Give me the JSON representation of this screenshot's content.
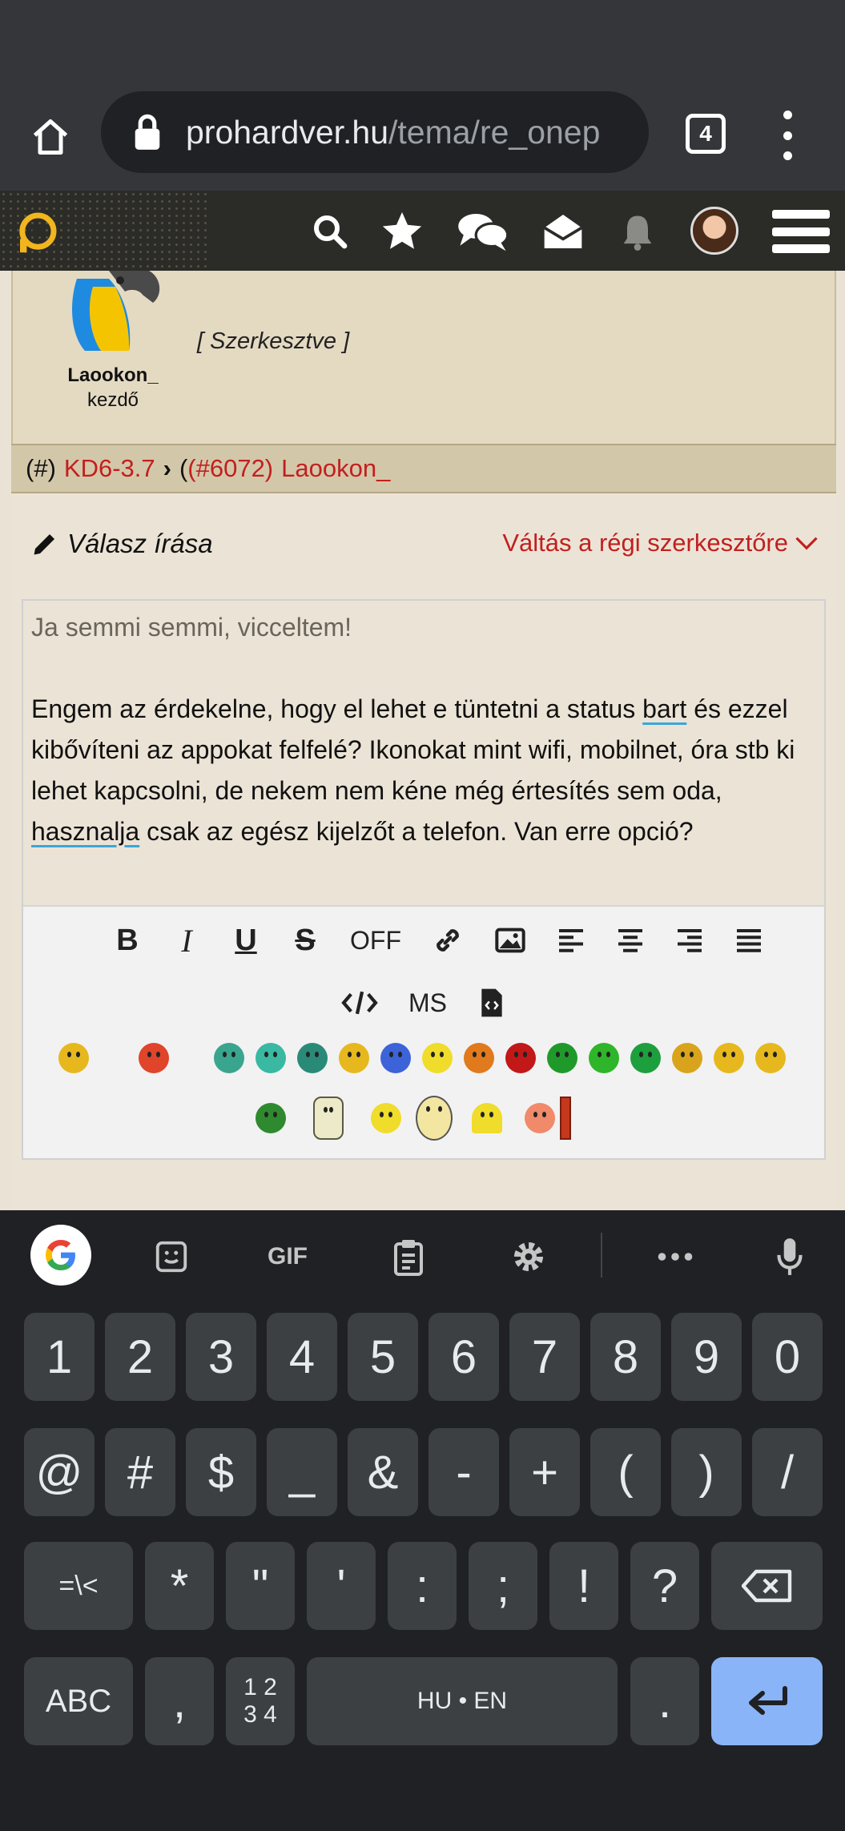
{
  "browser": {
    "url_host": "prohardver.hu",
    "url_path": "/tema/re_onep",
    "tab_count": "4"
  },
  "site_header": {
    "icons": [
      "logo-icon",
      "search-icon",
      "star-icon",
      "chat-icon",
      "envelope-open-icon",
      "bell-icon",
      "avatar",
      "hamburger-menu-icon"
    ]
  },
  "post": {
    "username": "Laookon_",
    "rank": "kezdő",
    "edited_note": "[ Szerkesztve ]"
  },
  "reference_bar": {
    "hash_label": "(#)",
    "topic": "KD6-3.7",
    "post_number": "(#6072)",
    "author": "Laookon_"
  },
  "reply": {
    "label": "Válasz írása",
    "switch_editor_label": "Váltás a régi szerkesztőre",
    "editor": {
      "first_line": "Ja semmi semmi, vicceltem!",
      "body_part1": "Engem az érdekelne, hogy el lehet e tüntetni a status ",
      "word_bart": "bart",
      "body_part2": " és ezzel kibővíteni az appokat felfelé? Ikonokat mint wifi, mobilnet, óra stb ki lehet kapcsolni, de nekem nem kéne még értesítés sem oda, ",
      "word_hasznalja": "hasznalja",
      "body_part3": " csak az egész kijelzőt a telefon. Van erre opció?"
    },
    "toolbar": {
      "bold": "B",
      "italic": "I",
      "underline": "U",
      "strike": "S",
      "off": "OFF",
      "ms": "MS"
    }
  },
  "keyboard": {
    "strip_gif": "GIF",
    "row1": [
      "1",
      "2",
      "3",
      "4",
      "5",
      "6",
      "7",
      "8",
      "9",
      "0"
    ],
    "row2": [
      "@",
      "#",
      "$",
      "_",
      "&",
      "-",
      "+",
      "(",
      ")",
      "/"
    ],
    "row3": [
      "=\\<",
      "*",
      "\"",
      "'",
      ":",
      ";",
      "!",
      "?"
    ],
    "abc": "ABC",
    "comma": ",",
    "numpad_top": "1 2",
    "numpad_bottom": "3 4",
    "space": "HU • EN",
    "period": "."
  }
}
